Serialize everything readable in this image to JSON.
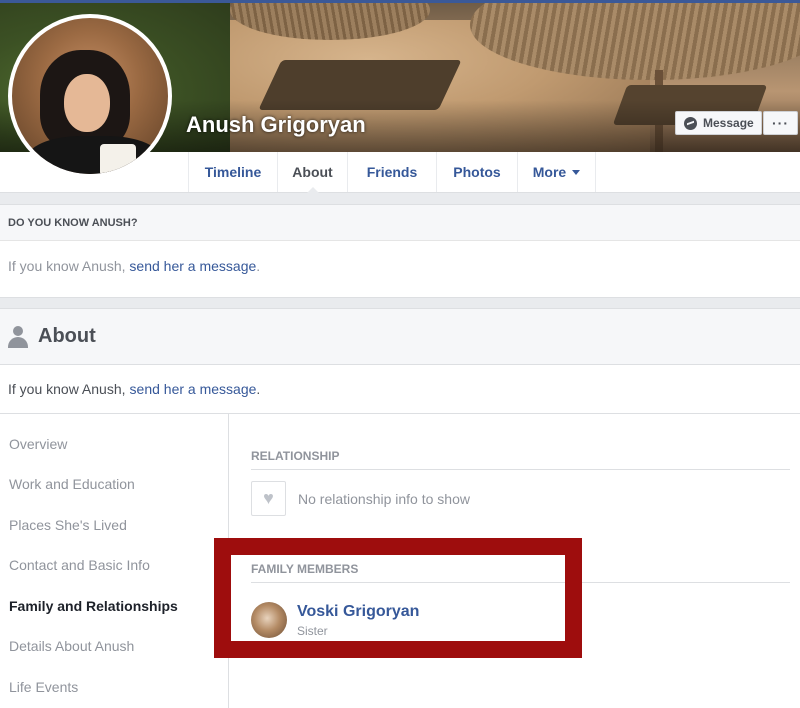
{
  "profile": {
    "name": "Anush Grigoryan",
    "message_button": "Message",
    "more_button": "···"
  },
  "tabs": [
    {
      "label": "Timeline"
    },
    {
      "label": "About"
    },
    {
      "label": "Friends"
    },
    {
      "label": "Photos"
    },
    {
      "label": "More"
    }
  ],
  "know_card": {
    "heading": "DO YOU KNOW ANUSH?",
    "text_prefix": "If you know Anush, ",
    "link_text": "send her a message",
    "text_suffix": "."
  },
  "about": {
    "title": "About",
    "know_prefix": "If you know Anush, ",
    "know_link": "send her a message",
    "know_suffix": ".",
    "nav": [
      {
        "label": "Overview"
      },
      {
        "label": "Work and Education"
      },
      {
        "label": "Places She's Lived"
      },
      {
        "label": "Contact and Basic Info"
      },
      {
        "label": "Family and Relationships"
      },
      {
        "label": "Details About Anush"
      },
      {
        "label": "Life Events"
      }
    ],
    "relationship": {
      "heading": "RELATIONSHIP",
      "empty_text": "No relationship info to show"
    },
    "family": {
      "heading": "FAMILY MEMBERS",
      "members": [
        {
          "name": "Voski Grigoryan",
          "relation": "Sister"
        }
      ]
    }
  },
  "colors": {
    "link": "#365899",
    "highlight": "#9e0d0d",
    "muted": "#90949c"
  }
}
